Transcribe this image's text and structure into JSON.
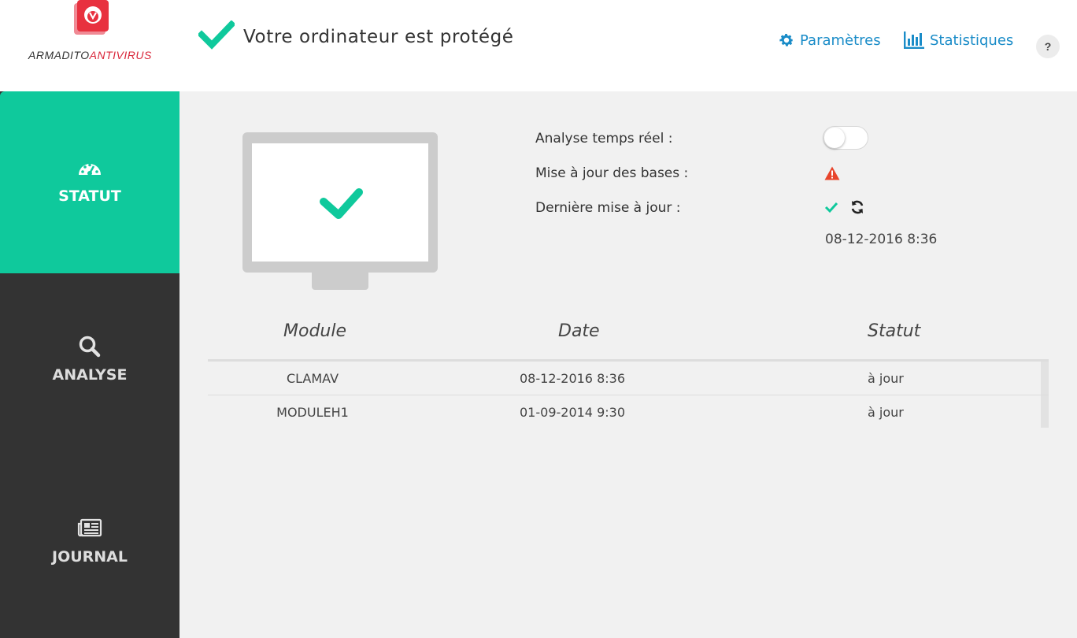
{
  "brand": {
    "name_part1": "ARMADITO",
    "name_part2": "ANTIVIRUS",
    "logo_color": "#d9263a"
  },
  "header": {
    "status_title": "Votre ordinateur est protégé",
    "nav": {
      "settings_label": "Paramètres",
      "stats_label": "Statistiques",
      "help_label": "?"
    }
  },
  "sidebar": {
    "items": [
      {
        "label": "STATUT",
        "icon": "dashboard-icon",
        "active": true
      },
      {
        "label": "ANALYSE",
        "icon": "search-icon",
        "active": false
      },
      {
        "label": "JOURNAL",
        "icon": "newspaper-icon",
        "active": false
      }
    ]
  },
  "status": {
    "realtime_label": "Analyse temps réel :",
    "realtime_enabled": false,
    "db_update_label": "Mise à jour des bases :",
    "db_update_state": "warning",
    "last_update_label": "Dernière mise à jour :",
    "last_update_date": "08-12-2016 8:36"
  },
  "modules_table": {
    "columns": [
      "Module",
      "Date",
      "Statut"
    ],
    "rows": [
      {
        "module": "CLAMAV",
        "date": "08-12-2016 8:36",
        "statut": "à jour"
      },
      {
        "module": "MODULEH1",
        "date": "01-09-2014 9:30",
        "statut": "à jour"
      }
    ]
  },
  "colors": {
    "accent": "#0fc99c",
    "link": "#1a8cc8",
    "warning": "#e8452c",
    "sidebar_bg": "#333333"
  }
}
